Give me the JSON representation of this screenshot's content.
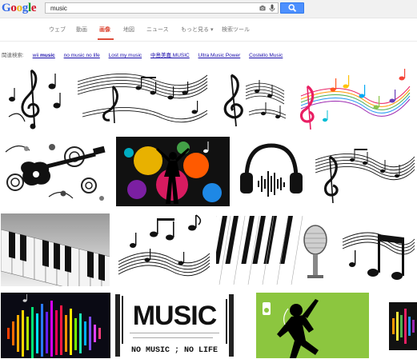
{
  "logo": {
    "text": "Google"
  },
  "search": {
    "query": "music"
  },
  "tabs": [
    {
      "label": "ウェブ"
    },
    {
      "label": "動画"
    },
    {
      "label": "画像",
      "active": true
    },
    {
      "label": "地図"
    },
    {
      "label": "ニュース"
    },
    {
      "label": "もっと見る ▾"
    },
    {
      "label": "検索ツール"
    }
  ],
  "related": {
    "label": "関連検索:",
    "items": [
      {
        "pre": "wii ",
        "bold": "music"
      },
      {
        "pre": "no music no life",
        "bold": ""
      },
      {
        "pre": "Lost my music",
        "bold": ""
      },
      {
        "pre": "中島美嘉 MUSIC",
        "bold": ""
      },
      {
        "pre": "Ultra Music Power",
        "bold": ""
      },
      {
        "pre": "Costello Music",
        "bold": ""
      }
    ]
  },
  "images": {
    "music_word": "MUSIC",
    "tagline": "NO MUSIC ; NO LIFE"
  },
  "colors": {
    "accent": "#dd4b39",
    "link": "#1a0dab",
    "button": "#4d90fe",
    "lime": "#8cc63f"
  }
}
